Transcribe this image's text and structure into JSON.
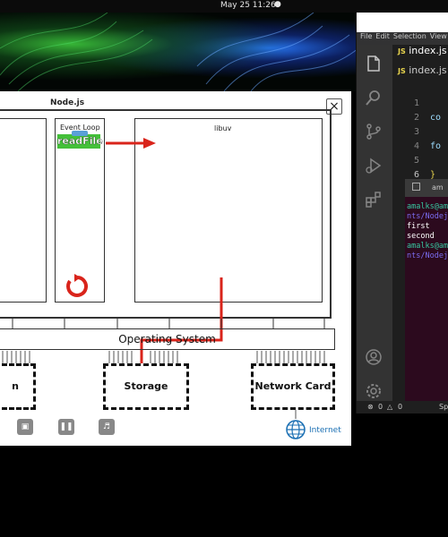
{
  "topbar": {
    "date_time": "May 25  11:26"
  },
  "vscode": {
    "menu": [
      "File",
      "Edit",
      "Selection",
      "View"
    ],
    "tab_label": "index.js",
    "breadcrumb": "index.js",
    "js_badge": "JS",
    "lines": [
      {
        "num": "1",
        "code": ""
      },
      {
        "num": "2",
        "code": "co"
      },
      {
        "num": "3",
        "code": ""
      },
      {
        "num": "4",
        "code": "fo"
      },
      {
        "num": "5",
        "code": ""
      },
      {
        "num": "6",
        "code": "}"
      }
    ],
    "terminal_tab": "am",
    "terminal_lines": [
      {
        "text": "amalks@ama",
        "color": "#37c8a0"
      },
      {
        "text": "nts/Nodejs",
        "color": "#7a6cf0"
      },
      {
        "text": "first",
        "color": "#ffffff"
      },
      {
        "text": "second",
        "color": "#ffffff"
      },
      {
        "text": "amalks@ama",
        "color": "#37c8a0"
      },
      {
        "text": "nts/Nodejs",
        "color": "#7a6cf0"
      }
    ],
    "status_errors": "0",
    "status_warnings": "0",
    "status_extra": "Sp"
  },
  "node_window": {
    "title": "Node.js",
    "event_loop_label": "Event Loop",
    "readfile_label": "readFile",
    "libuv_label": "libuv",
    "os_label": "Operating System",
    "devices": [
      "n",
      "Storage",
      "Network Card"
    ],
    "internet_label": "Internet",
    "colors": {
      "arrow": "#d9241b",
      "readfile_bg": "#44c03a",
      "loop_icon": "#d9241b"
    }
  }
}
